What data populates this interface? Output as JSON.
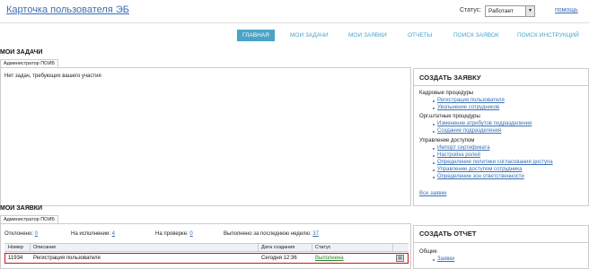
{
  "header": {
    "title": "Карточка пользователя ЭБ",
    "status_label": "Статус:",
    "status_value": "Работает",
    "help": "помощь"
  },
  "nav": {
    "items": [
      {
        "label": "ГЛАВНАЯ",
        "active": true
      },
      {
        "label": "МОИ ЗАДАЧИ",
        "active": false
      },
      {
        "label": "МОИ ЗАЯВКИ",
        "active": false
      },
      {
        "label": "ОТЧЕТЫ",
        "active": false
      },
      {
        "label": "ПОИСК ЗАЯВОК",
        "active": false
      },
      {
        "label": "ПОИСК ИНСТРУКЦИЙ",
        "active": false
      }
    ]
  },
  "tasks": {
    "title": "МОИ ЗАДАЧИ",
    "tab": "Администратор ПОИБ",
    "empty": "Нет задач, требующих вашего участия"
  },
  "create_request": {
    "title": "СОЗДАТЬ ЗАЯВКУ",
    "groups": [
      {
        "title": "Кадровые процедуры",
        "links": [
          "Регистрация пользователя",
          "Увольнение сотрудников"
        ]
      },
      {
        "title": "Орг.штатные процедуры",
        "links": [
          "Изменение атрибутов подразделения",
          "Создание подразделения"
        ]
      },
      {
        "title": "Управление доступом",
        "links": [
          "Импорт сертификата",
          "Настройка ролей",
          "Определение политики согласования доступа",
          "Управление доступом сотрудника",
          "Определение зон ответственности"
        ]
      }
    ],
    "all_link": "Все заявки"
  },
  "requests": {
    "title": "МОИ ЗАЯВКИ",
    "tab": "Администратор ПОИБ",
    "counters": [
      {
        "label": "Отклонено:",
        "value": "0"
      },
      {
        "label": "На исполнении:",
        "value": "4"
      },
      {
        "label": "На проверке:",
        "value": "0"
      },
      {
        "label": "Выполнено за последнюю неделю:",
        "value": "37"
      }
    ],
    "columns": [
      "Номер",
      "Описание",
      "Дата создания",
      "Статус"
    ],
    "rows": [
      {
        "number": "11934",
        "description": "Регистрация пользователя",
        "date": "Сегодня 12:36",
        "status": "Выполнена"
      }
    ]
  },
  "create_report": {
    "title": "СОЗДАТЬ ОТЧЕТ",
    "group": "Общие",
    "link": "Заявки"
  },
  "colors": {
    "accent": "#4aa3c8",
    "link": "#3a6fb5",
    "highlight": "#d0121b"
  }
}
